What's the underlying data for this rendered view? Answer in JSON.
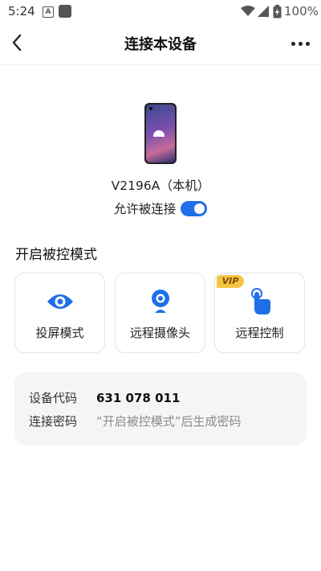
{
  "status_bar": {
    "time": "5:24",
    "battery_pct": "100%",
    "notif_a": "A"
  },
  "header": {
    "title": "连接本设备"
  },
  "device": {
    "name": "V2196A（本机）",
    "allow_label": "允许被连接",
    "allow_enabled": true
  },
  "section": {
    "title": "开启被控模式"
  },
  "modes": [
    {
      "label": "投屏模式",
      "icon": "eye-icon"
    },
    {
      "label": "远程摄像头",
      "icon": "webcam-icon"
    },
    {
      "label": "远程控制",
      "icon": "touch-hand-icon",
      "badge": "VIP"
    }
  ],
  "info": {
    "device_code_label": "设备代码",
    "device_code": "631 078 011",
    "password_label": "连接密码",
    "password_value": "“开启被控模式”后生成密码"
  },
  "colors": {
    "accent": "#1f6fe8",
    "vip": "#f5c542"
  }
}
